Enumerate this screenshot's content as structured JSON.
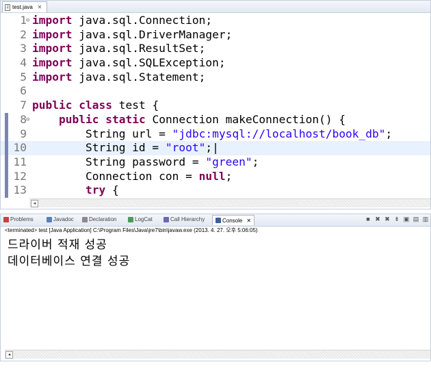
{
  "editor": {
    "tab_label": "test.java",
    "lines": [
      {
        "num": "1",
        "fold": "⊖",
        "tokens": [
          {
            "t": "import",
            "c": "kw"
          },
          {
            "t": " java.sql.Connection;",
            "c": ""
          }
        ]
      },
      {
        "num": "2",
        "fold": "",
        "tokens": [
          {
            "t": "import",
            "c": "kw"
          },
          {
            "t": " java.sql.DriverManager;",
            "c": ""
          }
        ]
      },
      {
        "num": "3",
        "fold": "",
        "tokens": [
          {
            "t": "import",
            "c": "kw"
          },
          {
            "t": " java.sql.ResultSet;",
            "c": ""
          }
        ]
      },
      {
        "num": "4",
        "fold": "",
        "tokens": [
          {
            "t": "import",
            "c": "kw"
          },
          {
            "t": " java.sql.SQLException;",
            "c": ""
          }
        ]
      },
      {
        "num": "5",
        "fold": "",
        "tokens": [
          {
            "t": "import",
            "c": "kw"
          },
          {
            "t": " java.sql.Statement;",
            "c": ""
          }
        ]
      },
      {
        "num": "6",
        "fold": "",
        "tokens": []
      },
      {
        "num": "7",
        "fold": "",
        "tokens": [
          {
            "t": "public",
            "c": "kw"
          },
          {
            "t": " ",
            "c": ""
          },
          {
            "t": "class",
            "c": "kw"
          },
          {
            "t": " test {",
            "c": ""
          }
        ]
      },
      {
        "num": "8",
        "fold": "⊖",
        "marker": true,
        "tokens": [
          {
            "t": "    ",
            "c": ""
          },
          {
            "t": "public",
            "c": "kw"
          },
          {
            "t": " ",
            "c": ""
          },
          {
            "t": "static",
            "c": "kw"
          },
          {
            "t": " Connection makeConnection() {",
            "c": ""
          }
        ]
      },
      {
        "num": "9",
        "fold": "",
        "marker": true,
        "tokens": [
          {
            "t": "        String url = ",
            "c": ""
          },
          {
            "t": "\"jdbc:mysql://localhost/book_db\"",
            "c": "str"
          },
          {
            "t": ";",
            "c": ""
          }
        ]
      },
      {
        "num": "10",
        "fold": "",
        "marker": true,
        "current": true,
        "tokens": [
          {
            "t": "        String id = ",
            "c": ""
          },
          {
            "t": "\"root\"",
            "c": "str"
          },
          {
            "t": ";|",
            "c": ""
          }
        ]
      },
      {
        "num": "11",
        "fold": "",
        "marker": true,
        "tokens": [
          {
            "t": "        String password = ",
            "c": ""
          },
          {
            "t": "\"green\"",
            "c": "str"
          },
          {
            "t": ";",
            "c": ""
          }
        ]
      },
      {
        "num": "12",
        "fold": "",
        "marker": true,
        "tokens": [
          {
            "t": "        Connection con = ",
            "c": ""
          },
          {
            "t": "null",
            "c": "kw"
          },
          {
            "t": ";",
            "c": ""
          }
        ]
      },
      {
        "num": "13",
        "fold": "",
        "marker": true,
        "tokens": [
          {
            "t": "        ",
            "c": ""
          },
          {
            "t": "try",
            "c": "kw"
          },
          {
            "t": " {",
            "c": ""
          }
        ]
      }
    ]
  },
  "views": {
    "tabs": [
      {
        "label": "Problems",
        "icon": "problems-icon",
        "color": "#c94040"
      },
      {
        "label": "Javadoc",
        "icon": "javadoc-icon",
        "color": "#5a7fb8"
      },
      {
        "label": "Declaration",
        "icon": "declaration-icon",
        "color": "#8a8a8a"
      },
      {
        "label": "LogCat",
        "icon": "logcat-icon",
        "color": "#4a9a5a"
      },
      {
        "label": "Call Hierarchy",
        "icon": "call-hierarchy-icon",
        "color": "#6a6ab0"
      },
      {
        "label": "Console",
        "icon": "console-icon",
        "color": "#3b5f9a",
        "active": true
      }
    ],
    "toolbar_icons": [
      "terminate-icon",
      "remove-launch-icon",
      "remove-all-icon",
      "scroll-lock-icon",
      "pin-console-icon",
      "display-console-icon",
      "open-console-icon"
    ]
  },
  "console": {
    "status": "<terminated> test [Java Application] C:\\Program Files\\Java\\jre7\\bin\\javaw.exe (2013. 4. 27. 오후 5:06:05)",
    "output": [
      "드라이버 적재 성공",
      "데이터베이스 연결 성공"
    ]
  }
}
